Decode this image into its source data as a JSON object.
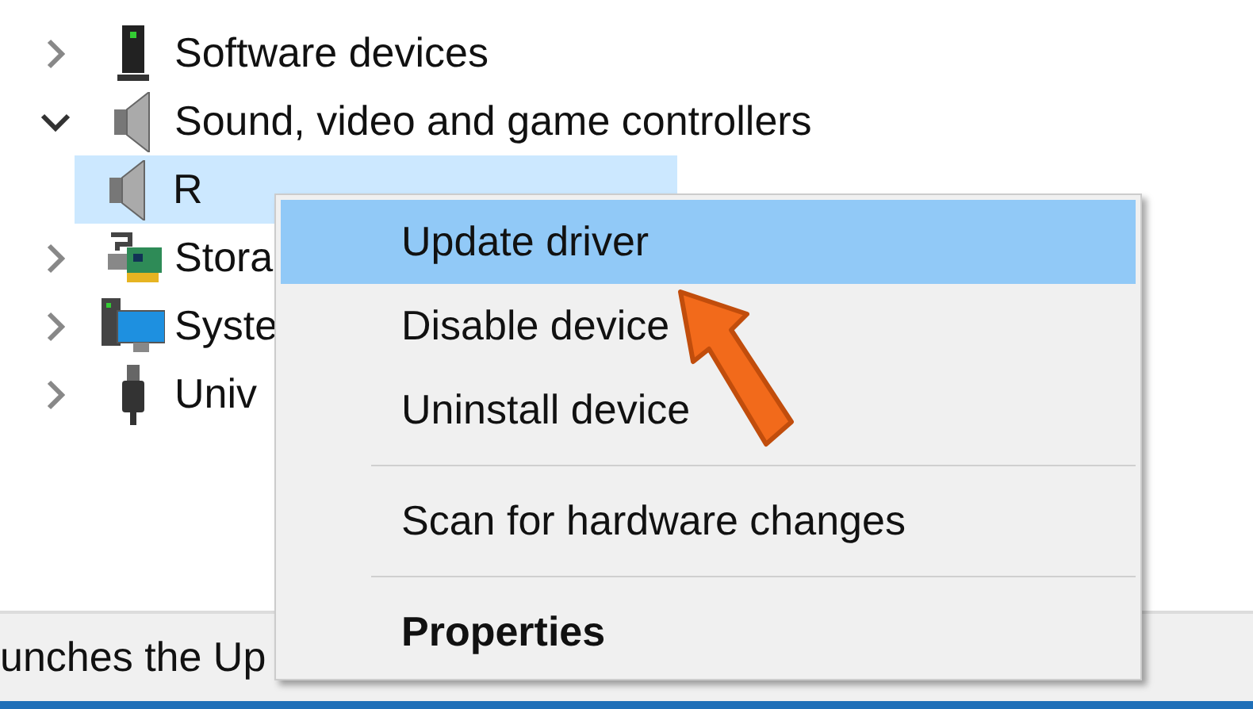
{
  "tree": [
    {
      "label": "Software devices",
      "kind": "software",
      "expanded": false
    },
    {
      "label": "Sound, video and game controllers",
      "kind": "sound",
      "expanded": true,
      "children": [
        {
          "label": "R",
          "kind": "sound",
          "selected": true
        }
      ]
    },
    {
      "label": "Stora",
      "kind": "storage",
      "expanded": false
    },
    {
      "label": "Syste",
      "kind": "system",
      "expanded": false
    },
    {
      "label": "Univ",
      "kind": "usb",
      "expanded": false
    }
  ],
  "context_menu": [
    {
      "kind": "item",
      "label": "Update driver",
      "selected": true,
      "default": false
    },
    {
      "kind": "item",
      "label": "Disable device",
      "selected": false,
      "default": false
    },
    {
      "kind": "item",
      "label": "Uninstall device",
      "selected": false,
      "default": false
    },
    {
      "kind": "separator"
    },
    {
      "kind": "item",
      "label": "Scan for hardware changes",
      "selected": false,
      "default": false
    },
    {
      "kind": "separator"
    },
    {
      "kind": "item",
      "label": "Properties",
      "selected": false,
      "default": true
    }
  ],
  "status_bar": {
    "text": "unches the Up"
  }
}
